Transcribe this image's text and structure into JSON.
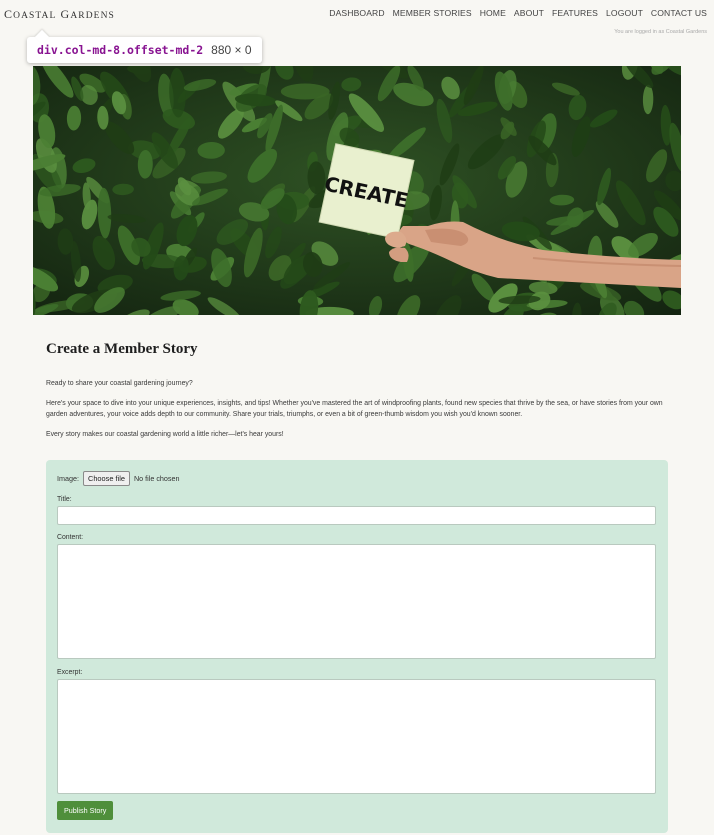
{
  "brand": {
    "first_big": "C",
    "first_small": "OASTAL",
    "second_big": "G",
    "second_small": "ARDENS"
  },
  "nav": [
    "DASHBOARD",
    "MEMBER STORIES",
    "HOME",
    "ABOUT",
    "FEATURES",
    "LOGOUT",
    "CONTACT US"
  ],
  "logged_in_text": "You are logged in as Coastal Gardens",
  "devtools_tooltip": {
    "selector": "div.col-md-8.offset-md-2",
    "dimensions": "880 × 0"
  },
  "hero": {
    "card_text": "CREATE"
  },
  "page": {
    "title": "Create a Member Story",
    "paragraphs": [
      "Ready to share your coastal gardening journey?",
      "Here's your space to dive into your unique experiences, insights, and tips! Whether you've mastered the art of windproofing plants, found new species that thrive by the sea, or have stories from your own garden adventures, your voice adds depth to our community. Share your trials, triumphs, or even a bit of green-thumb wisdom you wish you'd known sooner.",
      "Every story makes our coastal gardening world a little richer—let's hear yours!"
    ]
  },
  "form": {
    "image_label": "Image:",
    "file_button": "Choose file",
    "file_status": "No file chosen",
    "title_label": "Title:",
    "title_value": "",
    "content_label": "Content:",
    "content_value": "",
    "excerpt_label": "Excerpt:",
    "excerpt_value": "",
    "submit_label": "Publish Story"
  },
  "colors": {
    "form_bg": "#d0e9db",
    "button": "#4f8f3b",
    "page_bg": "#f8f7f3",
    "tooltip_selector": "#881391"
  }
}
